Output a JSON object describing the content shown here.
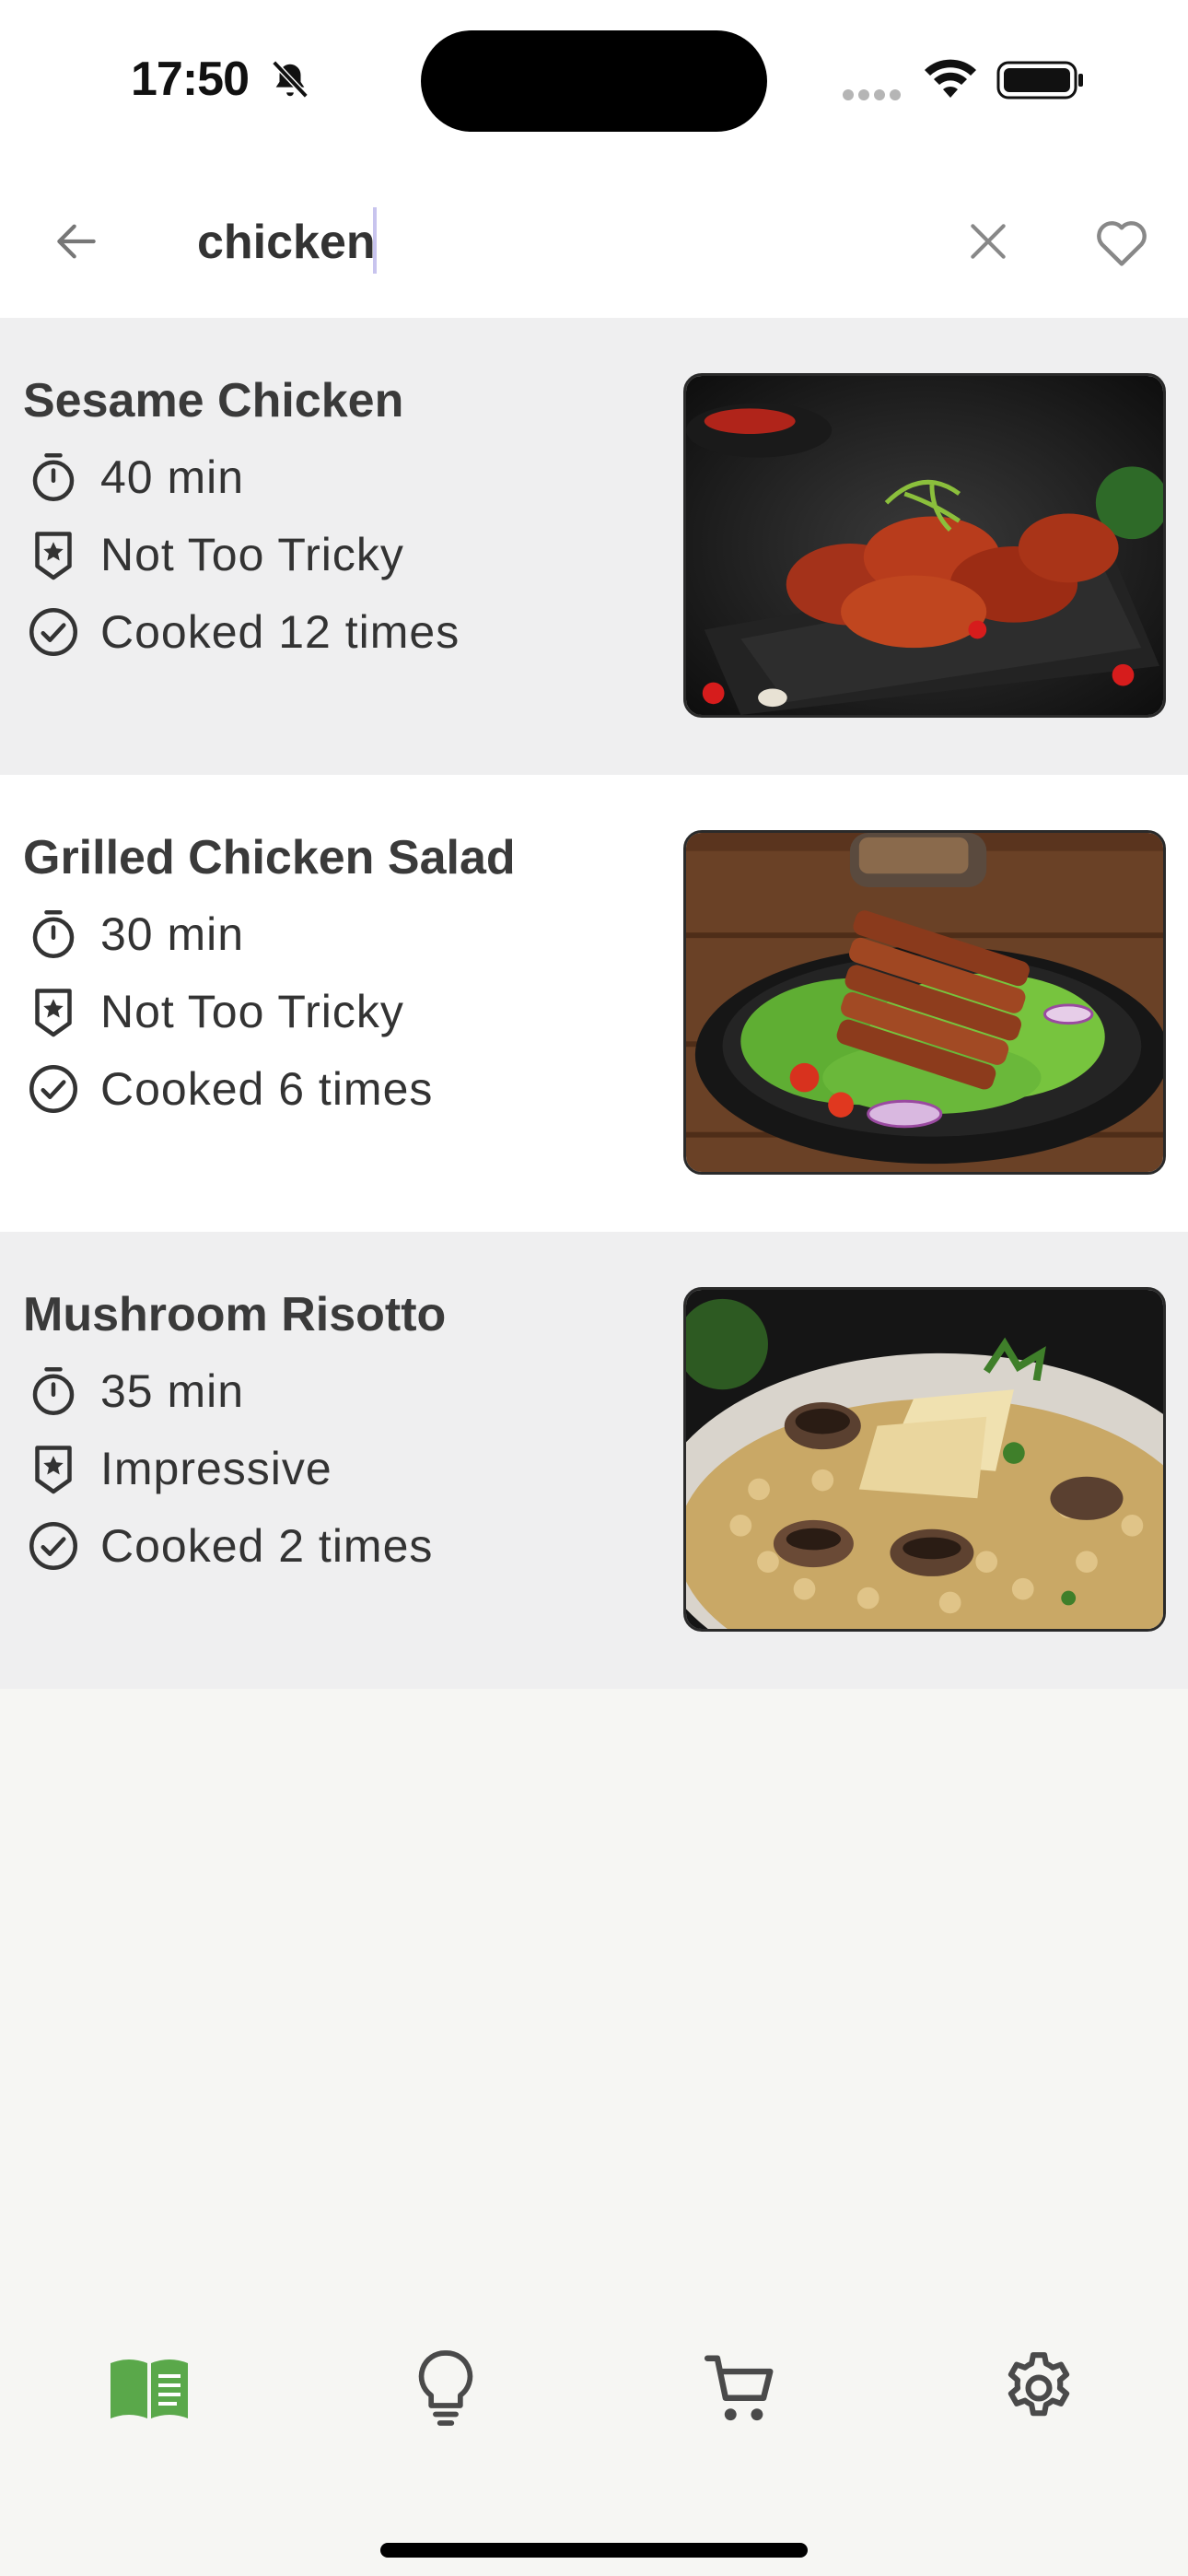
{
  "status_bar": {
    "time": "17:50",
    "icons": [
      "bell-slash-icon",
      "signal-icon",
      "wifi-icon",
      "battery-icon"
    ]
  },
  "search": {
    "value": "chicken",
    "back_icon": "arrow-left-icon",
    "clear_icon": "close-icon",
    "favorite_icon": "heart-outline-icon"
  },
  "results": [
    {
      "title": "Sesame Chicken",
      "time": "40 min",
      "difficulty": "Not Too Tricky",
      "cooked": "Cooked 12 times"
    },
    {
      "title": "Grilled Chicken Salad",
      "time": "30 min",
      "difficulty": "Not Too Tricky",
      "cooked": "Cooked 6 times"
    },
    {
      "title": "Mushroom Risotto",
      "time": "35 min",
      "difficulty": "Impressive",
      "cooked": "Cooked 2 times"
    }
  ],
  "bottom_nav": {
    "items": [
      "recipes-book-icon",
      "ideas-lightbulb-icon",
      "shopping-cart-icon",
      "settings-gear-icon"
    ],
    "active_index": 0,
    "active_color": "#5aa84a",
    "inactive_color": "#4a4a4a"
  },
  "colors": {
    "background": "#f6f6f3",
    "card_shaded": "#efeff0",
    "card_white": "#ffffff",
    "text": "#333333"
  }
}
